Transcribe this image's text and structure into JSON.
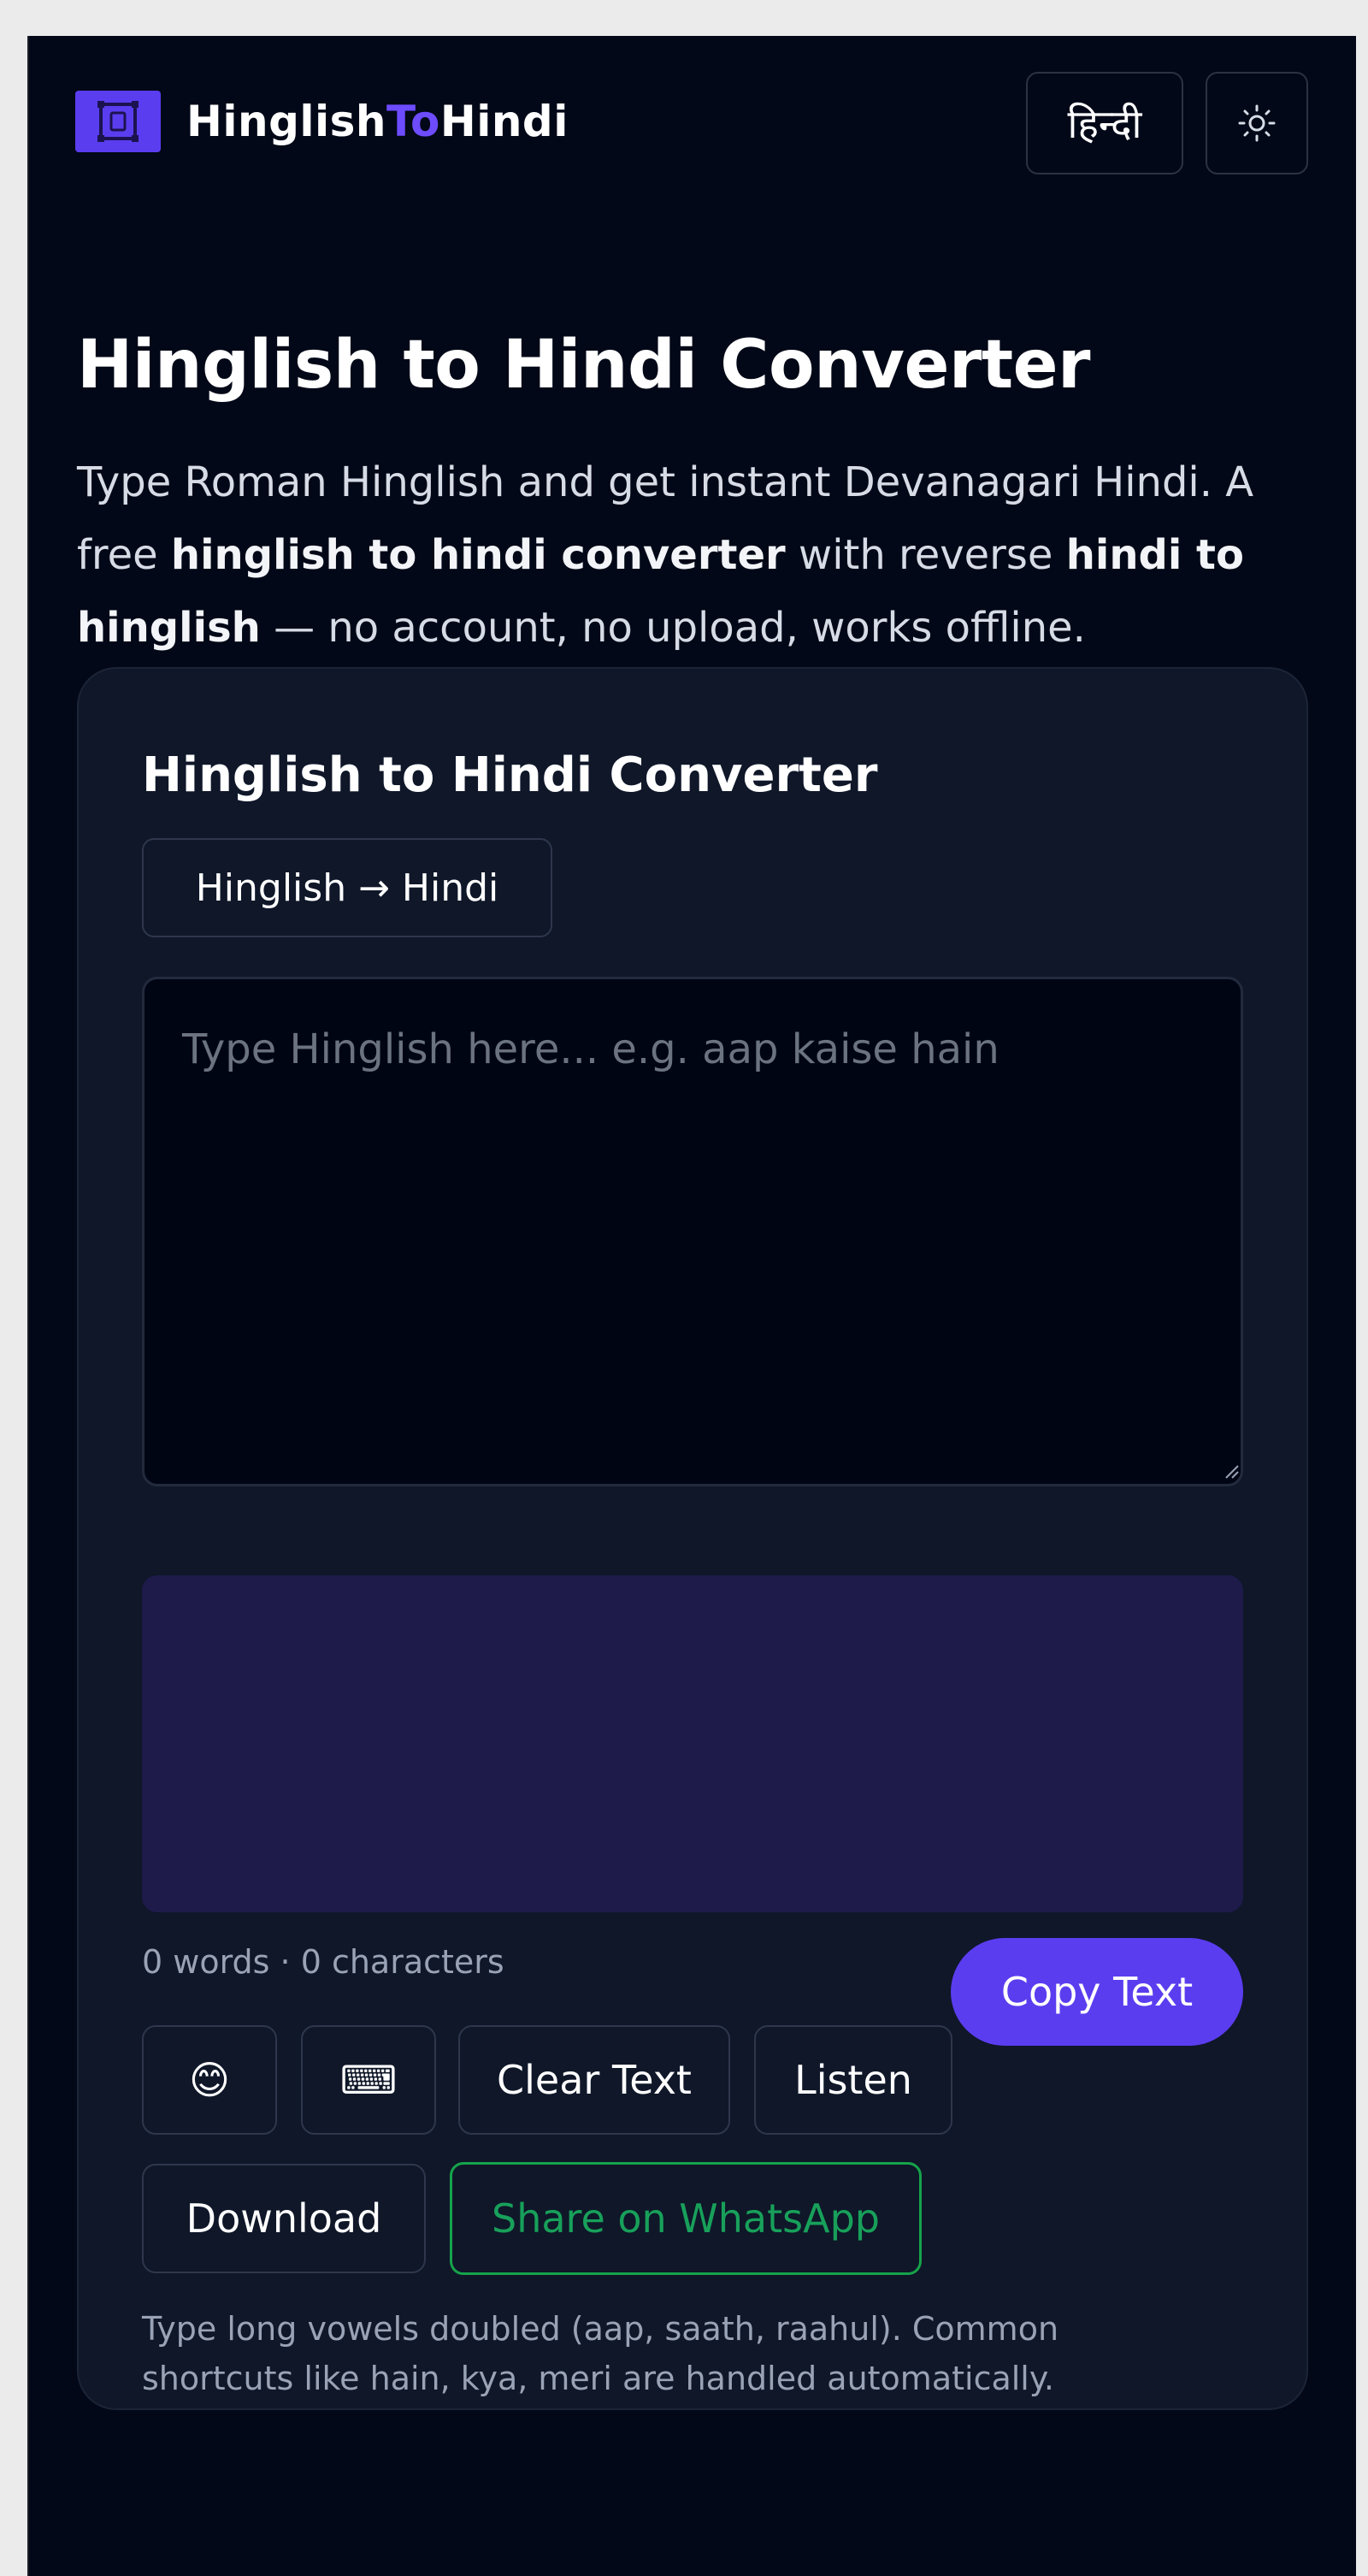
{
  "header": {
    "brand_prefix": "Hinglish",
    "brand_accent": "To",
    "brand_suffix": "Hindi",
    "lang_toggle_label": "हिन्दी",
    "theme_toggle_icon": "sun-icon"
  },
  "hero": {
    "title": "Hinglish to Hindi Converter",
    "intro_1": "Type Roman Hinglish and get instant Devanagari Hindi. A free ",
    "intro_bold_1": "hinglish to hindi converter",
    "intro_2": " with reverse ",
    "intro_bold_2": "hindi to hinglish",
    "intro_3": " — no account, no upload, works offline."
  },
  "converter": {
    "title": "Hinglish to Hindi Converter",
    "mode_label": "Hinglish → Hindi",
    "input_value": "",
    "input_placeholder": "Type Hinglish here... e.g. aap kaise hain",
    "output_value": "",
    "counts": "0 words · 0 characters",
    "copy_label": "Copy Text",
    "emoji_label": "😊",
    "keyboard_label": "⌨",
    "clear_label": "Clear Text",
    "listen_label": "Listen",
    "download_label": "Download",
    "whatsapp_label": "Share on WhatsApp",
    "hint": "Type long vowels doubled (aap, saath, raahul). Common shortcuts like hain, kya, meri are handled automatically."
  },
  "colors": {
    "background": "#020817",
    "card": "#0f1729",
    "accent": "#5b3df0",
    "output_bg": "#1e1b4b",
    "whatsapp": "#16a34a"
  }
}
